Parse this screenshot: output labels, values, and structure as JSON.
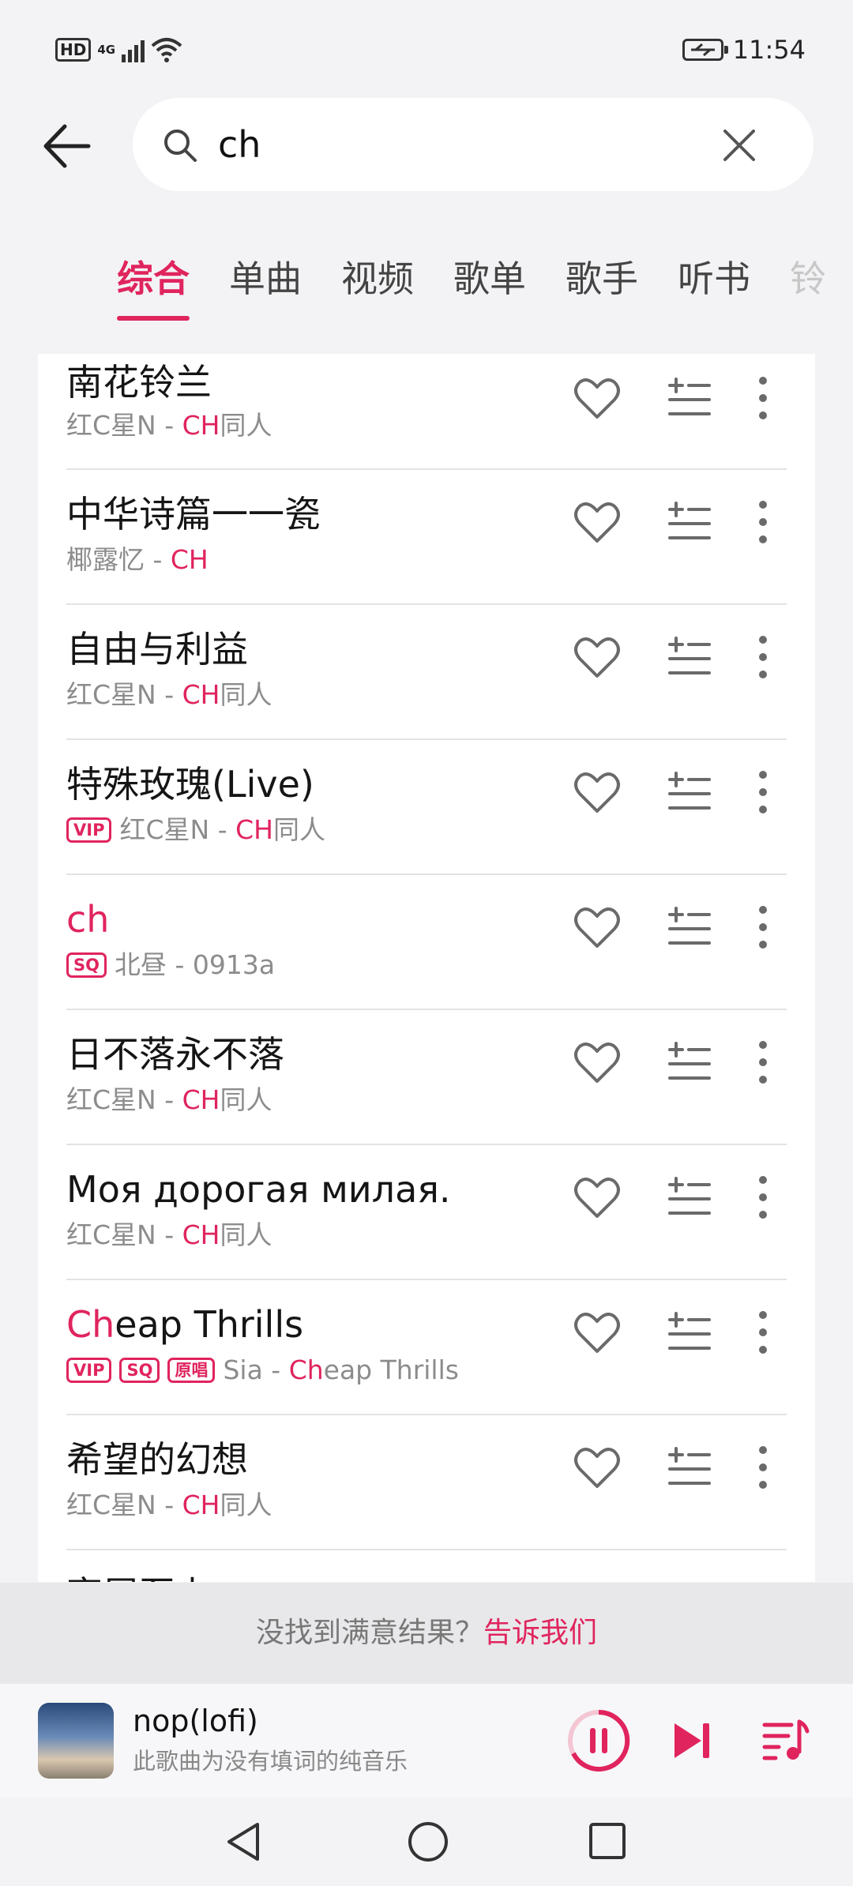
{
  "status_bar": {
    "hd": "HD",
    "signal": "4G",
    "time": "11:54"
  },
  "search": {
    "query": "ch"
  },
  "tabs": [
    {
      "label": "综合",
      "active": true
    },
    {
      "label": "单曲"
    },
    {
      "label": "视频"
    },
    {
      "label": "歌单"
    },
    {
      "label": "歌手"
    },
    {
      "label": "听书"
    },
    {
      "label": "铃"
    }
  ],
  "songs": [
    {
      "title": "南花铃兰",
      "badges": [],
      "artist": "红C星N",
      "sep": " - ",
      "album_hl": "CH",
      "album_rest": "同人"
    },
    {
      "title": "中华诗篇一一瓷",
      "badges": [],
      "artist": "椰露忆",
      "sep": " - ",
      "album_hl": "CH",
      "album_rest": ""
    },
    {
      "title": "自由与利益",
      "badges": [],
      "artist": "红C星N",
      "sep": " - ",
      "album_hl": "CH",
      "album_rest": "同人"
    },
    {
      "title": "特殊玫瑰(Live)",
      "badges": [
        "VIP"
      ],
      "artist": "红C星N",
      "sep": " - ",
      "album_hl": "CH",
      "album_rest": "同人"
    },
    {
      "title_hl": "ch",
      "title": "",
      "badges": [
        "SQ"
      ],
      "artist": "北昼",
      "sep": " - ",
      "album_hl": "",
      "album_rest": "0913a"
    },
    {
      "title": "日不落永不落",
      "badges": [],
      "artist": "红C星N",
      "sep": " - ",
      "album_hl": "CH",
      "album_rest": "同人"
    },
    {
      "title": "Моя дорогая милая.",
      "badges": [],
      "artist": "红C星N",
      "sep": " - ",
      "album_hl": "CH",
      "album_rest": "同人"
    },
    {
      "title_hl": "Ch",
      "title": "eap Thrills",
      "badges": [
        "VIP",
        "SQ",
        "原唱"
      ],
      "artist": "Sia",
      "sep": " - ",
      "album_hl": "Ch",
      "album_rest": "eap Thrills"
    },
    {
      "title": "希望的幻想",
      "badges": [],
      "artist": "红C星N",
      "sep": " - ",
      "album_hl": "CH",
      "album_rest": "同人"
    },
    {
      "title": "斋尾至上",
      "badges": [],
      "artist": "",
      "sep": "",
      "album_hl": "",
      "album_rest": ""
    }
  ],
  "feedback": {
    "text": "没找到满意结果？",
    "link": "告诉我们"
  },
  "player": {
    "title": "nop(lofi)",
    "subtitle": "此歌曲为没有填词的纯音乐"
  },
  "colors": {
    "accent": "#e0245e",
    "background": "#f3f3f5"
  }
}
